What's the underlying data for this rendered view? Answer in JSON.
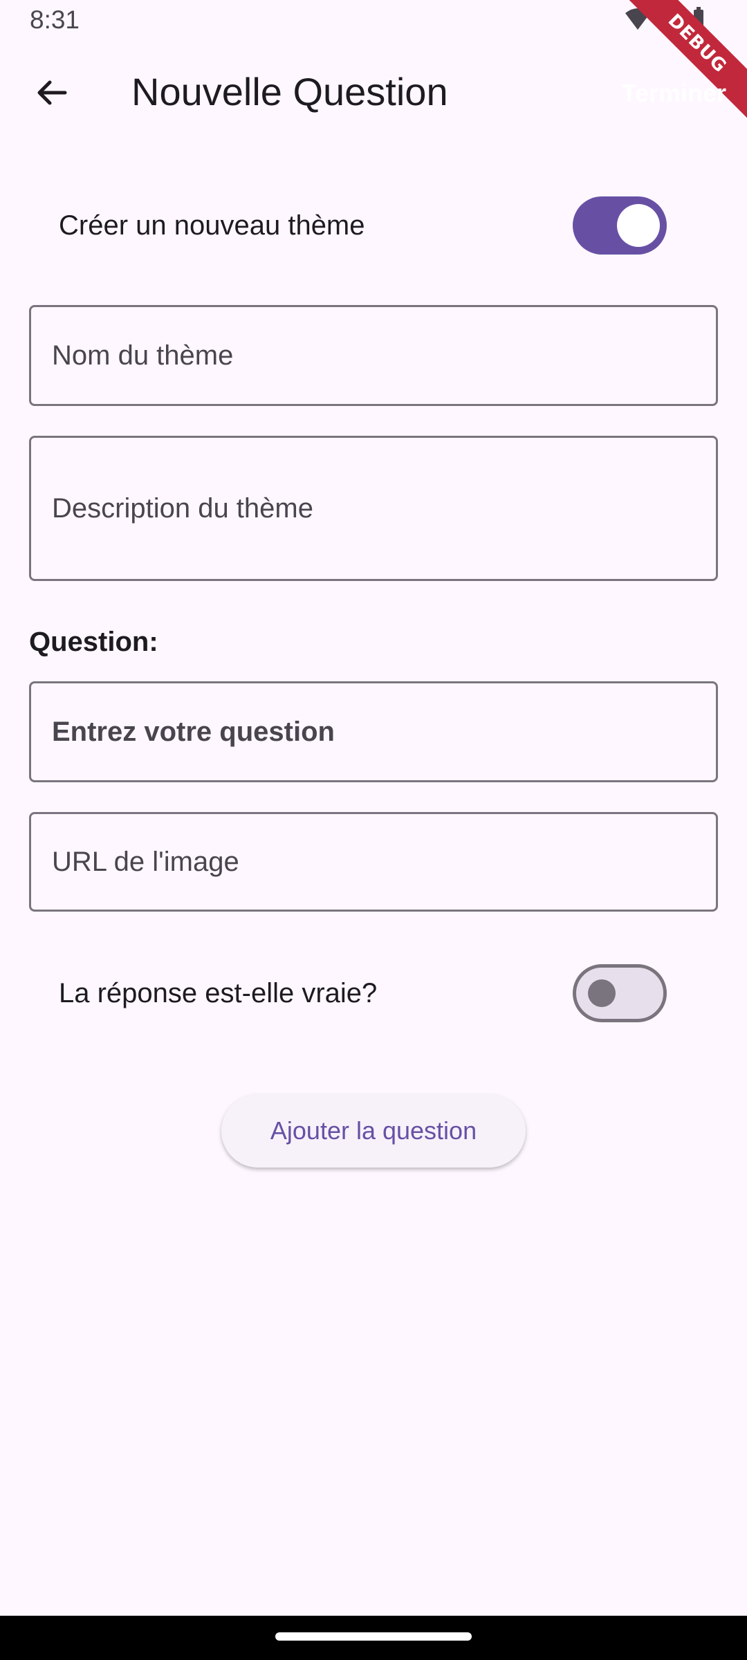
{
  "status_bar": {
    "time": "8:31",
    "icons": [
      "wifi-icon",
      "signal-icon",
      "battery-icon"
    ],
    "debug_banner": "DEBUG"
  },
  "app_bar": {
    "back_icon": "arrow-back-icon",
    "title": "Nouvelle Question",
    "action_label": "Terminer"
  },
  "theme_section": {
    "toggle_label": "Créer un nouveau thème",
    "toggle_on": true,
    "name_placeholder": "Nom du thème",
    "description_placeholder": "Description du thème"
  },
  "question_section": {
    "label": "Question:",
    "question_placeholder": "Entrez votre question",
    "image_url_placeholder": "URL de l'image",
    "answer_toggle_label": "La réponse est-elle vraie?",
    "answer_toggle_on": false,
    "submit_label": "Ajouter la question"
  },
  "colors": {
    "background": "#fef7ff",
    "primary": "#6750a4",
    "outline": "#79747e"
  }
}
